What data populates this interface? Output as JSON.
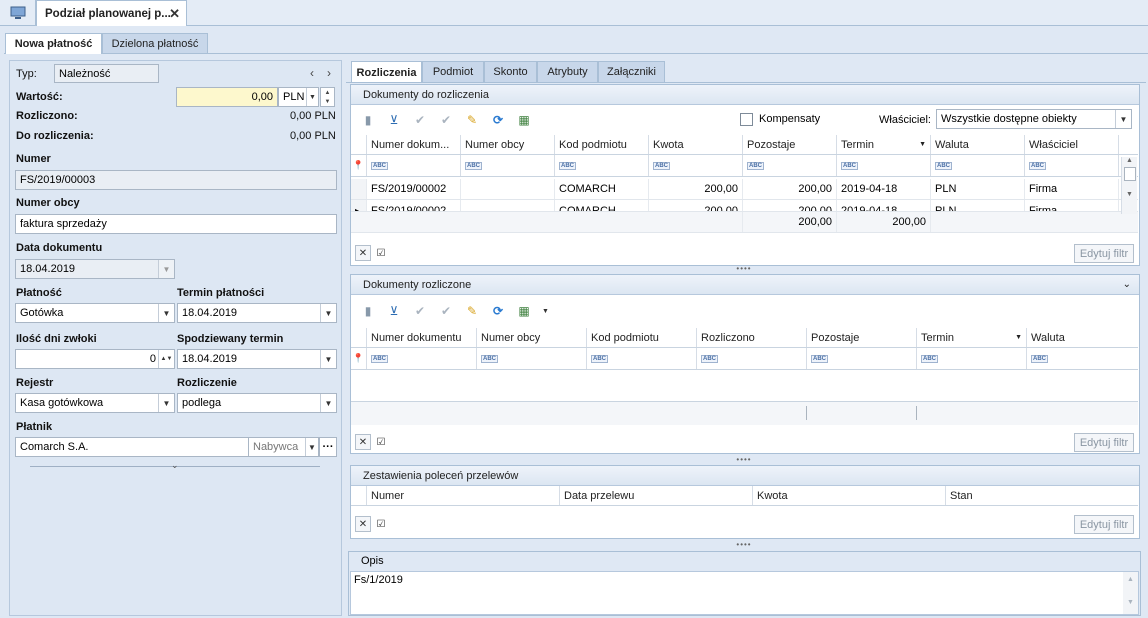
{
  "window": {
    "doc_tab_title": "Podział planowanej p...",
    "close": "✕"
  },
  "subtabs": [
    "Nowa płatność",
    "Dzielona płatność"
  ],
  "left": {
    "typ_label": "Typ:",
    "typ_value": "Należność",
    "wartosc_label": "Wartość:",
    "wartosc_value": "0,00",
    "currency": "PLN",
    "rozliczono_label": "Rozliczono:",
    "rozliczono_value": "0,00 PLN",
    "do_rozliczenia_label": "Do rozliczenia:",
    "do_rozliczenia_value": "0,00 PLN",
    "numer_label": "Numer",
    "numer_value": "FS/2019/00003",
    "numer_obcy_label": "Numer obcy",
    "numer_obcy_value": "faktura sprzedaży",
    "data_dok_label": "Data dokumentu",
    "data_dok_value": "18.04.2019",
    "platnosc_label": "Płatność",
    "platnosc_value": "Gotówka",
    "termin_platnosci_label": "Termin płatności",
    "termin_platnosci_value": "18.04.2019",
    "ilosc_dni_label": "Ilość dni zwłoki",
    "ilosc_dni_value": "0",
    "spodziewany_label": "Spodziewany termin",
    "spodziewany_value": "18.04.2019",
    "rejestr_label": "Rejestr",
    "rejestr_value": "Kasa gotówkowa",
    "rozliczenie_label": "Rozliczenie",
    "rozliczenie_value": "podlega",
    "platnik_label": "Płatnik",
    "platnik_value": "Comarch S.A.",
    "platnik_type": "Nabywca"
  },
  "right_tabs": [
    "Rozliczenia",
    "Podmiot",
    "Skonto",
    "Atrybuty",
    "Załączniki"
  ],
  "dokumenty_do_rozliczenia": {
    "title": "Dokumenty do rozliczenia",
    "kompensaty_label": "Kompensaty",
    "wlasciciel_label": "Właściciel:",
    "wlasciciel_value": "Wszystkie dostępne obiekty",
    "columns": [
      "Numer dokum...",
      "Numer obcy",
      "Kod podmiotu",
      "Kwota",
      "Pozostaje",
      "Termin",
      "Waluta",
      "Właściciel"
    ],
    "rows": [
      [
        "FS/2019/00002",
        "",
        "COMARCH",
        "200,00",
        "200,00",
        "2019-04-18",
        "PLN",
        "Firma"
      ],
      [
        "FS/2019/00002",
        "",
        "COMARCH",
        "200,00",
        "200,00",
        "2019-04-18",
        "PLN",
        "Firma"
      ]
    ],
    "totals": {
      "kwota": "200,00",
      "pozostaje": "200,00"
    },
    "edit_filter": "Edytuj filtr"
  },
  "dokumenty_rozliczone": {
    "title": "Dokumenty rozliczone",
    "columns": [
      "Numer dokumentu",
      "Numer obcy",
      "Kod podmiotu",
      "Rozliczono",
      "Pozostaje",
      "Termin",
      "Waluta"
    ],
    "edit_filter": "Edytuj filtr"
  },
  "zestawienia": {
    "title": "Zestawienia poleceń przelewów",
    "columns": [
      "Numer",
      "Data przelewu",
      "Kwota",
      "Stan"
    ],
    "edit_filter": "Edytuj filtr"
  },
  "opis": {
    "title": "Opis",
    "value": "Fs/1/2019"
  },
  "icons": [
    "monitor-icon",
    "prev-icon",
    "next-icon",
    "filter-icon",
    "pin-icon",
    "close-filter-icon",
    "check-icon"
  ]
}
